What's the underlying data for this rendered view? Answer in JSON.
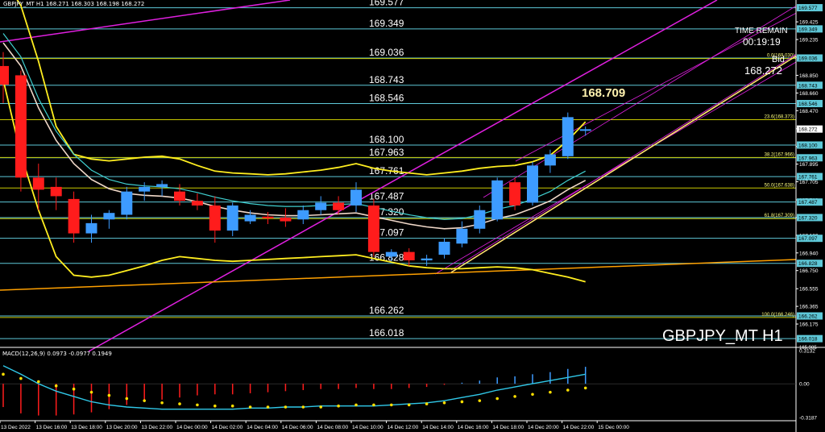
{
  "header": {
    "info": "GBPJPY_MT H1  168.271 168.303 168.198 168.272"
  },
  "watermark": {
    "symbol": "GBPJPY_MT H1"
  },
  "timer": {
    "title": "TIME REMAIN",
    "value": "00:19:19",
    "bid_label": "Bid",
    "bid_value": "168.272"
  },
  "current_high_label": "168.709",
  "price_axis": {
    "ticks": [
      "169.425",
      "169.235",
      "169.045",
      "168.850",
      "168.660",
      "168.470",
      "168.275",
      "168.085",
      "167.895",
      "167.705",
      "167.510",
      "167.320",
      "167.130",
      "166.940",
      "166.750",
      "166.555",
      "166.365",
      "166.175"
    ],
    "badges": [
      "169.577",
      "169.349",
      "169.036",
      "168.743",
      "168.546",
      "168.272",
      "168.100",
      "167.963",
      "167.761",
      "167.487",
      "167.320",
      "167.097",
      "166.828",
      "166.262",
      "166.018"
    ]
  },
  "pivot_levels": [
    "169.577",
    "169.349",
    "169.036",
    "168.743",
    "168.546",
    "168.100",
    "167.963",
    "167.761",
    "167.487",
    "167.320",
    "167.097",
    "166.828",
    "166.262",
    "166.018"
  ],
  "fib_levels": [
    "0.0(169.030)",
    "23.6(168.373)",
    "38.2(167.966)",
    "50.0(167.638)",
    "61.8(167.309)",
    "100.0(166.246)"
  ],
  "macd": {
    "title": "MACD(12,26,9) 0.0973 -0.0977 0.1949",
    "axis_ticks": [
      "0.3132",
      "0.00",
      "-0.3187"
    ],
    "top_value": "165.985"
  },
  "time_axis": [
    "13 Dec 2022",
    "13 Dec 16:00",
    "13 Dec 18:00",
    "13 Dec 20:00",
    "13 Dec 22:00",
    "14 Dec 00:00",
    "14 Dec 02:00",
    "14 Dec 04:00",
    "14 Dec 06:00",
    "14 Dec 08:00",
    "14 Dec 10:00",
    "14 Dec 12:00",
    "14 Dec 14:00",
    "14 Dec 16:00",
    "14 Dec 18:00",
    "14 Dec 20:00",
    "14 Dec 22:00",
    "15 Dec 00:00"
  ],
  "colors": {
    "bull": "#3d9bff",
    "bear": "#ff1c1c",
    "pivot_line": "#5ec8d8",
    "bollinger": "#ffee20",
    "channel": "#e020e0",
    "macd_signal": "#ffe000",
    "macd_main": "#30c8e8"
  },
  "chart_data": {
    "type": "candlestick",
    "symbol": "GBPJPY_MT",
    "timeframe": "H1",
    "candles": [
      {
        "o": 168.95,
        "h": 169.1,
        "l": 168.55,
        "c": 168.75
      },
      {
        "o": 168.85,
        "h": 168.9,
        "l": 167.6,
        "c": 167.75
      },
      {
        "o": 167.75,
        "h": 167.9,
        "l": 167.4,
        "c": 167.62
      },
      {
        "o": 167.65,
        "h": 167.75,
        "l": 167.4,
        "c": 167.55
      },
      {
        "o": 167.52,
        "h": 167.6,
        "l": 167.05,
        "c": 167.15
      },
      {
        "o": 167.15,
        "h": 167.35,
        "l": 167.05,
        "c": 167.26
      },
      {
        "o": 167.3,
        "h": 167.4,
        "l": 167.2,
        "c": 167.37
      },
      {
        "o": 167.35,
        "h": 167.65,
        "l": 167.3,
        "c": 167.6
      },
      {
        "o": 167.6,
        "h": 167.7,
        "l": 167.5,
        "c": 167.65
      },
      {
        "o": 167.65,
        "h": 167.72,
        "l": 167.55,
        "c": 167.68
      },
      {
        "o": 167.6,
        "h": 167.68,
        "l": 167.45,
        "c": 167.5
      },
      {
        "o": 167.5,
        "h": 167.58,
        "l": 167.4,
        "c": 167.45
      },
      {
        "o": 167.45,
        "h": 167.55,
        "l": 167.05,
        "c": 167.18
      },
      {
        "o": 167.18,
        "h": 167.48,
        "l": 167.12,
        "c": 167.45
      },
      {
        "o": 167.28,
        "h": 167.4,
        "l": 167.25,
        "c": 167.35
      },
      {
        "o": 167.33,
        "h": 167.38,
        "l": 167.25,
        "c": 167.32
      },
      {
        "o": 167.32,
        "h": 167.42,
        "l": 167.22,
        "c": 167.28
      },
      {
        "o": 167.3,
        "h": 167.45,
        "l": 167.25,
        "c": 167.4
      },
      {
        "o": 167.4,
        "h": 167.55,
        "l": 167.35,
        "c": 167.48
      },
      {
        "o": 167.48,
        "h": 167.55,
        "l": 167.35,
        "c": 167.4
      },
      {
        "o": 167.45,
        "h": 167.7,
        "l": 167.38,
        "c": 167.62
      },
      {
        "o": 167.45,
        "h": 167.52,
        "l": 166.9,
        "c": 166.95
      },
      {
        "o": 166.9,
        "h": 166.98,
        "l": 166.85,
        "c": 166.95
      },
      {
        "o": 166.95,
        "h": 166.99,
        "l": 166.8,
        "c": 166.86
      },
      {
        "o": 166.86,
        "h": 166.92,
        "l": 166.8,
        "c": 166.88
      },
      {
        "o": 166.92,
        "h": 167.1,
        "l": 166.88,
        "c": 167.06
      },
      {
        "o": 167.04,
        "h": 167.28,
        "l": 167.0,
        "c": 167.2
      },
      {
        "o": 167.2,
        "h": 167.45,
        "l": 167.15,
        "c": 167.4
      },
      {
        "o": 167.3,
        "h": 167.75,
        "l": 167.28,
        "c": 167.72
      },
      {
        "o": 167.7,
        "h": 167.75,
        "l": 167.4,
        "c": 167.45
      },
      {
        "o": 167.48,
        "h": 167.92,
        "l": 167.45,
        "c": 167.88
      },
      {
        "o": 167.88,
        "h": 168.05,
        "l": 167.8,
        "c": 168.0
      },
      {
        "o": 167.98,
        "h": 168.45,
        "l": 167.95,
        "c": 168.4
      },
      {
        "o": 168.27,
        "h": 168.3,
        "l": 168.2,
        "c": 168.27
      }
    ],
    "bollinger_upper": [
      169.9,
      169.6,
      169.0,
      168.3,
      168.0,
      167.95,
      167.93,
      167.95,
      167.97,
      167.98,
      167.95,
      167.88,
      167.82,
      167.8,
      167.79,
      167.78,
      167.79,
      167.81,
      167.83,
      167.86,
      167.9,
      167.85,
      167.82,
      167.8,
      167.78,
      167.8,
      167.82,
      167.85,
      167.87,
      167.88,
      167.92,
      167.99,
      168.15,
      168.35
    ],
    "bollinger_mid": [
      169.2,
      168.95,
      168.5,
      168.15,
      167.9,
      167.73,
      167.63,
      167.58,
      167.56,
      167.55,
      167.53,
      167.49,
      167.44,
      167.4,
      167.37,
      167.35,
      167.34,
      167.34,
      167.35,
      167.36,
      167.37,
      167.33,
      167.29,
      167.25,
      167.22,
      167.2,
      167.21,
      167.25,
      167.31,
      167.35,
      167.42,
      167.5,
      167.62,
      167.72
    ],
    "bollinger_lower": [
      168.8,
      168.0,
      167.4,
      166.9,
      166.7,
      166.68,
      166.7,
      166.75,
      166.8,
      166.86,
      166.9,
      166.88,
      166.86,
      166.85,
      166.86,
      166.87,
      166.88,
      166.89,
      166.9,
      166.91,
      166.92,
      166.88,
      166.84,
      166.8,
      166.78,
      166.77,
      166.77,
      166.78,
      166.79,
      166.78,
      166.76,
      166.72,
      166.68,
      166.63
    ],
    "macd_histogram": [
      -0.22,
      -0.28,
      -0.3,
      -0.3,
      -0.29,
      -0.27,
      -0.24,
      -0.2,
      -0.17,
      -0.15,
      -0.13,
      -0.11,
      -0.1,
      -0.1,
      -0.09,
      -0.08,
      -0.07,
      -0.06,
      -0.05,
      -0.05,
      -0.04,
      -0.05,
      -0.05,
      -0.04,
      -0.03,
      -0.01,
      0.01,
      0.03,
      0.06,
      0.07,
      0.09,
      0.11,
      0.14,
      0.16
    ],
    "macd_signal": [
      0.09,
      0.05,
      0.02,
      -0.02,
      -0.05,
      -0.08,
      -0.11,
      -0.14,
      -0.16,
      -0.18,
      -0.19,
      -0.2,
      -0.21,
      -0.21,
      -0.22,
      -0.22,
      -0.22,
      -0.22,
      -0.22,
      -0.21,
      -0.2,
      -0.2,
      -0.2,
      -0.2,
      -0.19,
      -0.18,
      -0.17,
      -0.16,
      -0.14,
      -0.12,
      -0.1,
      -0.08,
      -0.06,
      -0.04
    ],
    "macd_main": [
      0.17,
      0.09,
      0.0,
      -0.07,
      -0.12,
      -0.17,
      -0.2,
      -0.22,
      -0.23,
      -0.24,
      -0.24,
      -0.24,
      -0.24,
      -0.24,
      -0.23,
      -0.23,
      -0.22,
      -0.22,
      -0.21,
      -0.21,
      -0.21,
      -0.21,
      -0.2,
      -0.19,
      -0.18,
      -0.16,
      -0.13,
      -0.1,
      -0.06,
      -0.03,
      0.0,
      0.03,
      0.06,
      0.09
    ]
  }
}
